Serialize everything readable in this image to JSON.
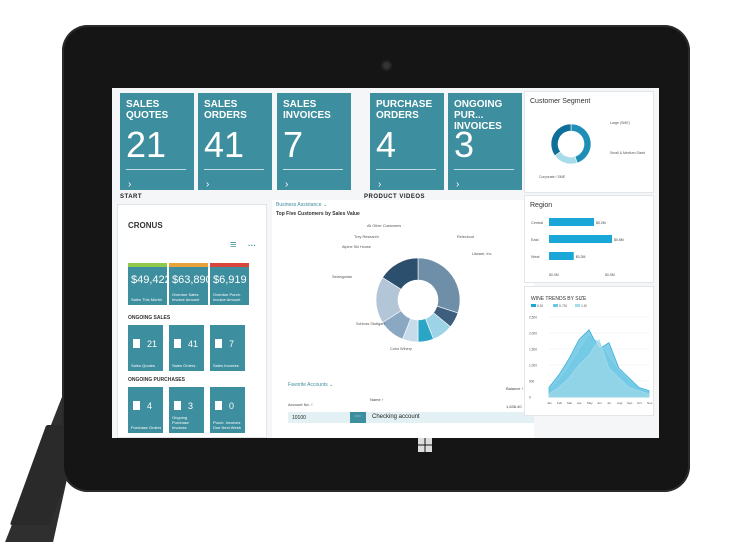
{
  "dashboard": {
    "tiles": [
      {
        "title": "SALES QUOTES",
        "value": "21"
      },
      {
        "title": "SALES ORDERS",
        "value": "41"
      },
      {
        "title": "SALES INVOICES",
        "value": "7"
      },
      {
        "title": "PURCHASE ORDERS",
        "value": "4"
      },
      {
        "title": "ONGOING PUR... INVOICES",
        "value": "3"
      }
    ],
    "tile_chevron": "›",
    "section_start": "START",
    "section_videos": "PRODUCT VIDEOS"
  },
  "cronus": {
    "title": "CRONUS",
    "menu_icon": "≡",
    "more": "···",
    "kpis": [
      {
        "value": "$49,422",
        "label": "Sales This Month",
        "bar": "#8fc94e"
      },
      {
        "value": "$63,890",
        "label": "Overdue Sales Invoice Amount",
        "bar": "#e8a23a"
      },
      {
        "value": "$6,919",
        "label": "Overdue Purch. Invoice Amount",
        "bar": "#d9453b"
      }
    ],
    "ongoing_sales_label": "ONGOING SALES",
    "ongoing_sales": [
      {
        "n": "21",
        "label": "Sales Quotes"
      },
      {
        "n": "41",
        "label": "Sales Orders"
      },
      {
        "n": "7",
        "label": "Sales Invoices"
      }
    ],
    "ongoing_purchases_label": "ONGOING PURCHASES",
    "ongoing_purchases": [
      {
        "n": "4",
        "label": "Purchase Orders"
      },
      {
        "n": "3",
        "label": "Ongoing Purchase Invoices"
      },
      {
        "n": "0",
        "label": "Purch. Invoices Due Next Week"
      }
    ]
  },
  "business": {
    "link": "Business Assistance ⌄",
    "title": "Top Five Customers by Sales Value",
    "segments": [
      "All Other Customers",
      "Trey Research",
      "Alpine Ski House",
      "Selangorian",
      "Schloss Stuttgart",
      "Relecloud",
      "Coho Winery",
      "Litware, Inc."
    ],
    "colors": [
      "#6f8fa8",
      "#3d5f7d",
      "#9cd3e6",
      "#2ba5c6",
      "#c7dcea",
      "#8aa8c2",
      "#b3c6d8",
      "#2d4f6e"
    ],
    "values": [
      30,
      6,
      8,
      6,
      6,
      10,
      18,
      16
    ]
  },
  "favorites": {
    "title": "Favorite Accounts ⌄",
    "col_no": "Account No. ↑",
    "col_name": "Name ↑",
    "col_balance": "Balance ↑",
    "row_balance_top": "1,638.40",
    "row_no": "10100",
    "row_name": "Checking account",
    "row_more": "⋯"
  },
  "segment_panel": {
    "title": "Customer Segment",
    "legend": [
      "Large (SME)",
      "Small & Medium Sized",
      "Corporate / SME"
    ],
    "colors": [
      "#1f8fb8",
      "#a8dcea",
      "#0e6f9a"
    ],
    "values": [
      45,
      20,
      35
    ]
  },
  "region": {
    "title": "Region",
    "categories": [
      "Central",
      "East",
      "West"
    ],
    "values": [
      40,
      56,
      22
    ],
    "labels": [
      "$0.2M",
      "$0.6M",
      "$0.2M"
    ],
    "axis": [
      "$0.0M",
      "$0.5M"
    ],
    "color": "#1aa6d6"
  },
  "wine": {
    "title": "WINE TRENDS BY SIZE",
    "legend": [
      "0.5l",
      "0.75l",
      "1.5l"
    ],
    "colors": [
      "#1aa6d6",
      "#6cc7e4",
      "#a8dcea"
    ],
    "yaxis": [
      "2,500",
      "2,000",
      "1,500",
      "1,000",
      "500",
      "0"
    ],
    "months": [
      "Jan",
      "Feb",
      "Mar",
      "Apr",
      "May",
      "Jun",
      "Jul",
      "Aug",
      "Sep",
      "Oct",
      "Nov"
    ],
    "series": [
      [
        300,
        700,
        1200,
        1800,
        2100,
        1500,
        1700,
        900,
        600,
        300,
        200
      ],
      [
        200,
        500,
        900,
        1400,
        1900,
        1700,
        1200,
        800,
        500,
        250,
        150
      ],
      [
        100,
        300,
        600,
        1000,
        1300,
        1800,
        900,
        600,
        300,
        200,
        100
      ]
    ]
  },
  "windows_logo": "windows-logo"
}
